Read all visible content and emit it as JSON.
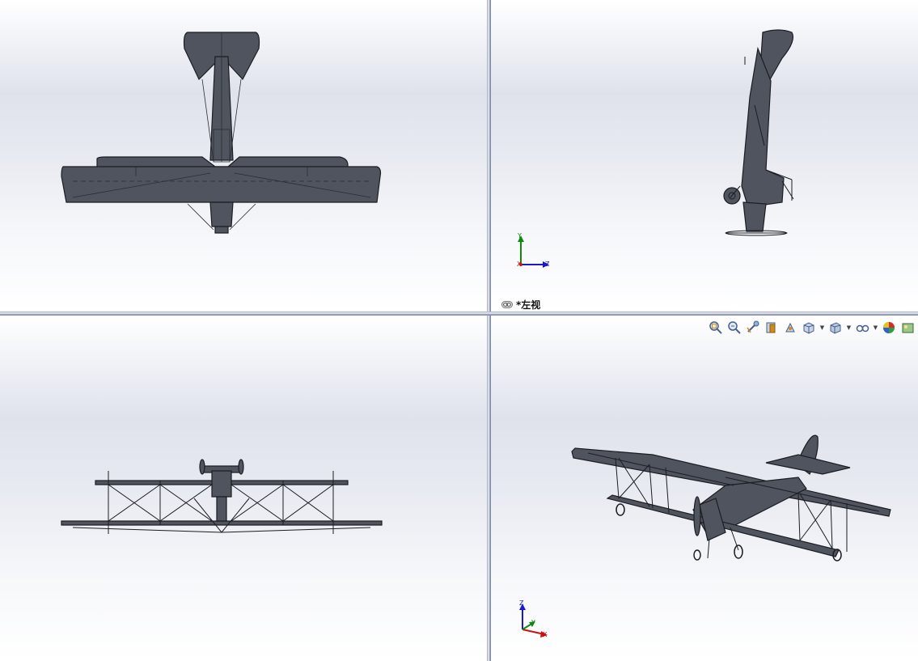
{
  "viewports": {
    "top_left": {
      "name": "top-view"
    },
    "top_right": {
      "name": "left-view",
      "label": "*左视",
      "triad": {
        "axis_1": "Y",
        "axis_2": "Z",
        "axis_3": "X"
      }
    },
    "bottom_left": {
      "name": "front-view"
    },
    "bottom_right": {
      "name": "isometric-view",
      "triad": {
        "axis_1": "Z",
        "axis_2": "Y",
        "axis_3": "X"
      }
    }
  },
  "heads_up_toolbar": {
    "icons": [
      "zoom-to-fit-icon",
      "zoom-to-area-icon",
      "previous-view-icon",
      "section-view-icon",
      "dynamic-annotation-icon",
      "view-orientation-icon",
      "display-style-icon",
      "hide-show-items-icon",
      "edit-appearance-icon",
      "apply-scene-icon"
    ]
  },
  "colors": {
    "model_fill": "#4f545e",
    "model_edge": "#1b1d22",
    "axis_x": "#cc1111",
    "axis_y": "#0f8a0f",
    "axis_z": "#1a1acc"
  }
}
